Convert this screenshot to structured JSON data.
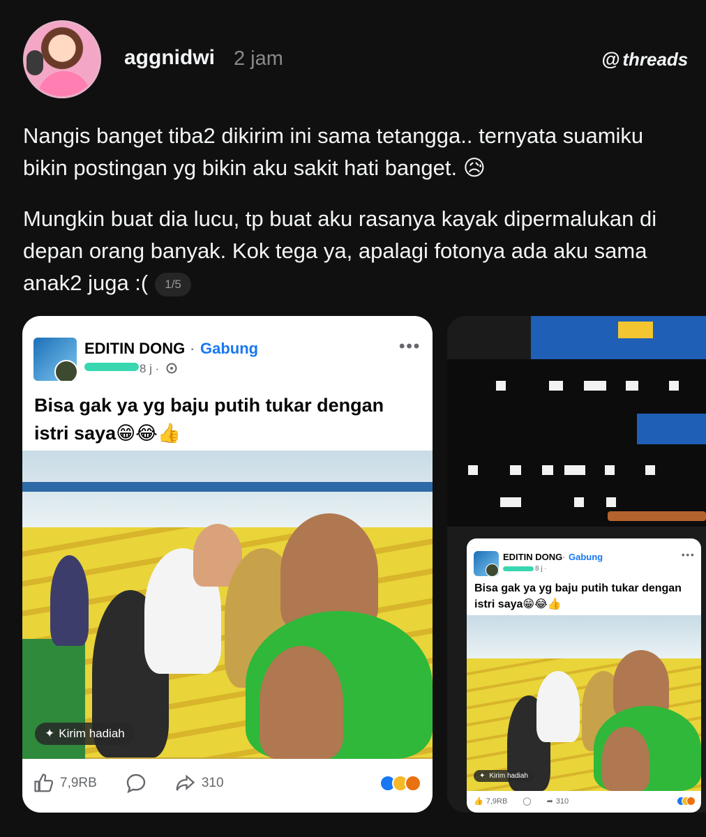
{
  "post": {
    "username": "aggnidwi",
    "time": "2 jam",
    "brand": "threads",
    "brand_icon": "threads-at-icon",
    "paragraphs": [
      "Nangis banget tiba2 dikirim ini sama tetangga.. ternyata suamiku bikin postingan yg bikin aku sakit hati banget. 😥",
      "Mungkin buat dia lucu, tp buat aku rasanya kayak dipermalukan di depan orang banyak. Kok tega ya, apalagi fotonya ada aku sama anak2 juga :("
    ],
    "counter": "1/5"
  },
  "fb_card": {
    "group_name": "EDITIN DONG",
    "separator": "·",
    "join_label": "Gabung",
    "meta_time": "8 j ·",
    "more_icon": "more-dots-icon",
    "globe_icon": "globe-icon",
    "caption": "Bisa gak ya yg baju putih tukar dengan istri saya😁😂👍",
    "gift_label": "Kirim hadiah",
    "gift_icon": "gift-icon",
    "like_count": "7,9RB",
    "share_count": "310",
    "like_icon": "like-thumb-icon",
    "comment_icon": "comment-bubble-icon",
    "share_icon": "share-arrow-icon"
  },
  "colors": {
    "background": "#101010",
    "fb_blue": "#1877f2",
    "meta_gray": "#65676b"
  }
}
